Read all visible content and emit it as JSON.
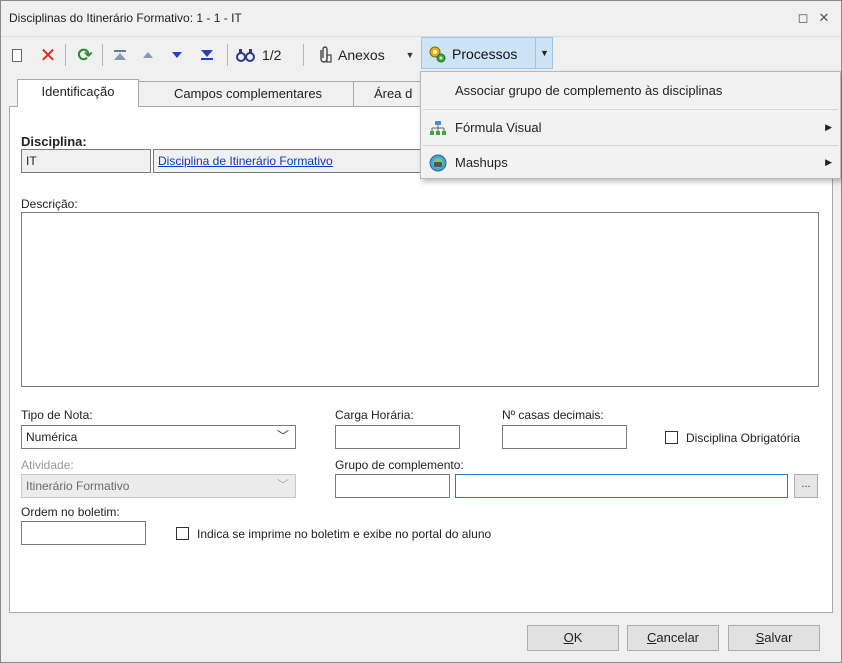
{
  "window": {
    "title": "Disciplinas do Itinerário Formativo: 1 - 1 - IT",
    "maximize_glyph": "◻",
    "close_glyph": "✕"
  },
  "toolbar": {
    "page_indicator": "1/2",
    "anexos_label": "Anexos",
    "processos_label": "Processos",
    "icons": [
      "new-document-icon",
      "delete-icon",
      "refresh-icon",
      "first-record-icon",
      "previous-record-icon",
      "next-record-icon",
      "last-record-icon",
      "find-icon",
      "attachment-icon",
      "processes-gear-icon"
    ]
  },
  "processos_menu": {
    "items": [
      {
        "label": "Associar grupo de complemento às disciplinas",
        "icon": "",
        "submenu": false
      },
      {
        "label": "Fórmula Visual",
        "icon": "visual-formula-icon",
        "submenu": true
      },
      {
        "label": "Mashups",
        "icon": "mashups-icon",
        "submenu": true
      }
    ]
  },
  "tabs": [
    {
      "label": "Identificação",
      "active": true
    },
    {
      "label": "Campos complementares",
      "active": false
    },
    {
      "label": "Área d",
      "active": false
    }
  ],
  "form": {
    "disciplina_label": "Disciplina:",
    "disciplina_code": "IT",
    "disciplina_name": "Disciplina de Itinerário Formativo",
    "descricao_label": "Descrição:",
    "descricao_value": "",
    "tipo_nota_label": "Tipo de Nota:",
    "tipo_nota_value": "Numérica",
    "carga_horaria_label": "Carga Horária:",
    "carga_horaria_value": "",
    "casas_decimais_label": "Nº casas decimais:",
    "casas_decimais_value": "",
    "obrigatoria_label": "Disciplina Obrigatória",
    "obrigatoria_checked": false,
    "atividade_label": "Atividade:",
    "atividade_value": "Itinerário Formativo",
    "grupo_complemento_label": "Grupo de complemento:",
    "grupo_code_value": "",
    "grupo_desc_value": "",
    "ellipsis_label": "...",
    "ordem_boletim_label": "Ordem no boletim:",
    "ordem_boletim_value": "",
    "imprime_boletim_label": "Indica se imprime no boletim e exibe no portal do aluno",
    "imprime_boletim_checked": false
  },
  "buttons": {
    "ok_label": "OK",
    "cancelar_label": "Cancelar",
    "salvar_label": "Salvar"
  }
}
